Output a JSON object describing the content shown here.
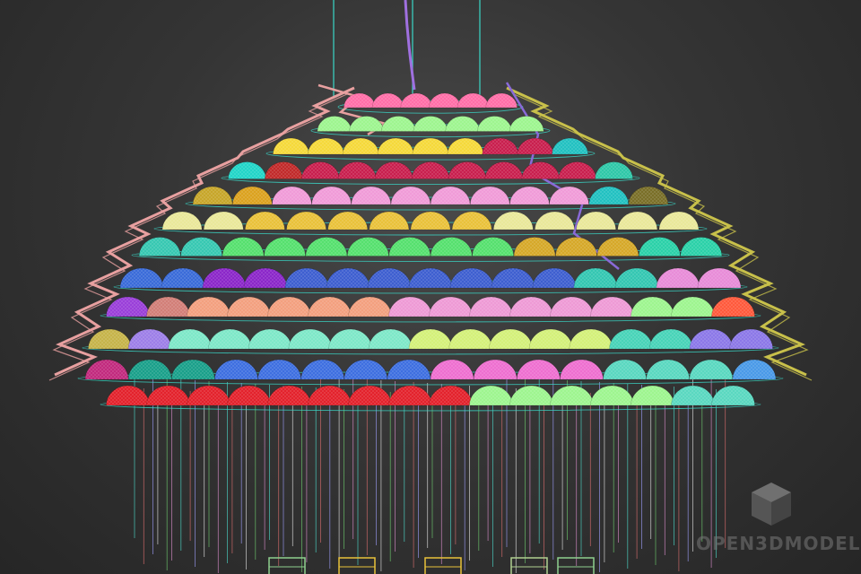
{
  "scene": {
    "subject": "domed-chandelier-wireframe",
    "background_color": "#333333",
    "tier_colors": [
      [
        "#ff6fa8",
        "#ff6fa8",
        "#ff6fa8",
        "#ff6fa8",
        "#ff6fa8",
        "#ff6fa8"
      ],
      [
        "#9ef58f",
        "#9ef58f",
        "#9ef58f",
        "#9ef58f",
        "#9ef58f",
        "#9ef58f",
        "#9ef58f"
      ],
      [
        "#f5d93a",
        "#f5d93a",
        "#f5d93a",
        "#f5d93a",
        "#f5d93a",
        "#f5d93a",
        "#c91f4e",
        "#c91f4e",
        "#22c1c1"
      ],
      [
        "#22d5c8",
        "#c22a2a",
        "#c91f4e",
        "#c91f4e",
        "#c91f4e",
        "#c91f4e",
        "#c91f4e",
        "#c91f4e",
        "#c91f4e",
        "#c91f4e",
        "#2fc8a8"
      ],
      [
        "#c7a62a",
        "#dba21f",
        "#f09bd8",
        "#f09bd8",
        "#f09bd8",
        "#f09bd8",
        "#f09bd8",
        "#f09bd8",
        "#f09bd8",
        "#f09bd8",
        "#22c1c1",
        "#7a6f28"
      ],
      [
        "#e9e89a",
        "#e9e89a",
        "#e9c23a",
        "#e9c23a",
        "#e9c23a",
        "#e9c23a",
        "#e9c23a",
        "#e9c23a",
        "#e9e89a",
        "#e9e89a",
        "#e9e89a",
        "#e9e89a",
        "#e9e89a"
      ],
      [
        "#37c8b2",
        "#37c8b2",
        "#56e06e",
        "#56e06e",
        "#56e06e",
        "#56e06e",
        "#56e06e",
        "#56e06e",
        "#56e06e",
        "#d6a829",
        "#d6a829",
        "#d6a829",
        "#2bd1a8",
        "#2bd1a8"
      ],
      [
        "#3a6bd9",
        "#3a6bd9",
        "#8b27c9",
        "#8b27c9",
        "#3e5fd0",
        "#3e5fd0",
        "#3e5fd0",
        "#3e5fd0",
        "#3e5fd0",
        "#3e5fd0",
        "#3e5fd0",
        "#34c7b2",
        "#34c7b2",
        "#e88cd8",
        "#e88cd8"
      ],
      [
        "#9a3fd9",
        "#d27f78",
        "#f3a07f",
        "#f3a07f",
        "#f3a07f",
        "#f3a07f",
        "#f3a07f",
        "#ee9ad5",
        "#ee9ad5",
        "#ee9ad5",
        "#ee9ad5",
        "#ee9ad5",
        "#ee9ad5",
        "#9ef58f",
        "#9ef58f",
        "#ff5a3c"
      ],
      [
        "#c6b44a",
        "#9d7fe8",
        "#7ee8c8",
        "#7ee8c8",
        "#7ee8c8",
        "#7ee8c8",
        "#7ee8c8",
        "#7ee8c8",
        "#d4f07a",
        "#d4f07a",
        "#d4f07a",
        "#d4f07a",
        "#d4f07a",
        "#48d4b8",
        "#48d4b8",
        "#8c78e8",
        "#8c78e8"
      ],
      [
        "#c22a7e",
        "#1aa08a",
        "#1aa08a",
        "#3e6fe0",
        "#3e6fe0",
        "#3e6fe0",
        "#3e6fe0",
        "#3e6fe0",
        "#ee6fd0",
        "#ee6fd0",
        "#ee6fd0",
        "#ee6fd0",
        "#5ad8c0",
        "#5ad8c0",
        "#5ad8c0",
        "#4a9ae8"
      ],
      [
        "#e3222c",
        "#e3222c",
        "#e3222c",
        "#e3222c",
        "#e3222c",
        "#e3222c",
        "#e3222c",
        "#e3222c",
        "#e3222c",
        "#9ef58f",
        "#9ef58f",
        "#9ef58f",
        "#9ef58f",
        "#9ef58f",
        "#5ad8c0",
        "#5ad8c0"
      ]
    ],
    "zigzag_color_left": "#e8a0a0",
    "zigzag_color_right": "#c8c04a",
    "zigzag_color_accent": "#8a6ad8",
    "ring_color": "#3ad8c8",
    "suspension_wire_color": "#3ad8c8",
    "cable_color": "#a070e0"
  },
  "watermark": {
    "icon": "cube-icon",
    "text": "OPEN3DMODEL"
  }
}
